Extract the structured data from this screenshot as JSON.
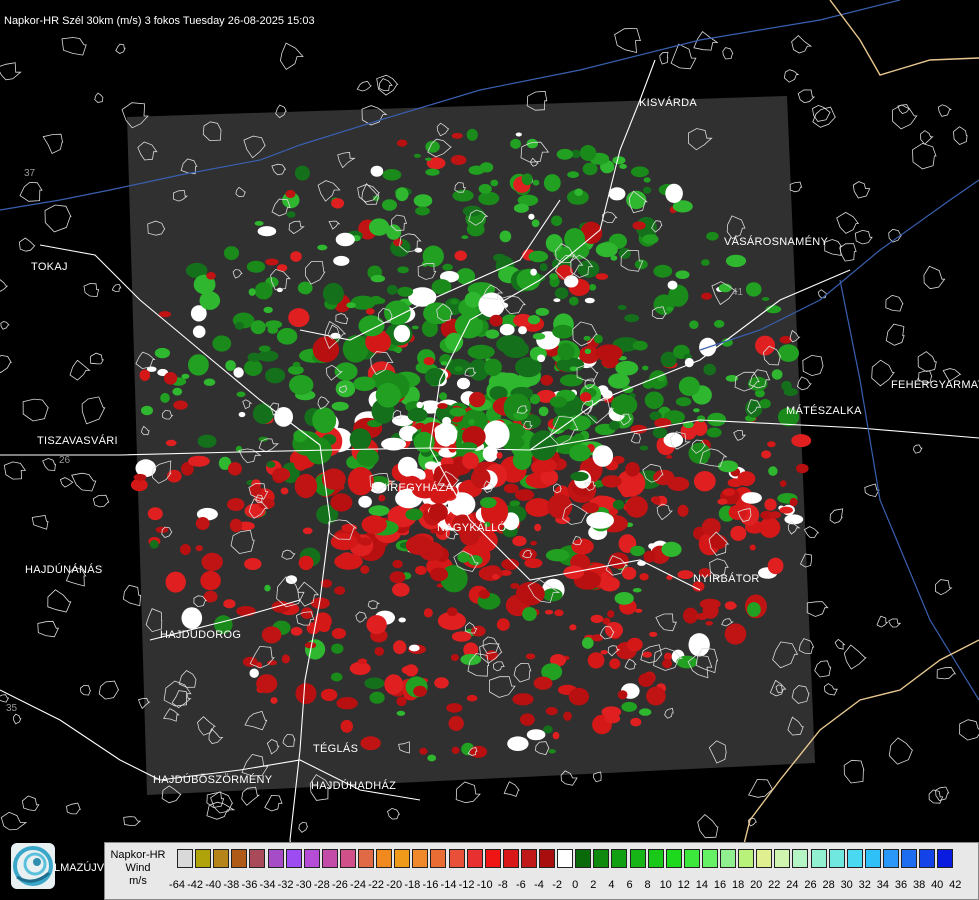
{
  "title": "Napkor-HR Szél 30km (m/s) 3 fokos Tuesday 26-08-2025 15:03",
  "cities": [
    {
      "name": "KISVÁRDA",
      "key": "kisvarda"
    },
    {
      "name": "TOKAJ",
      "key": "tokaj"
    },
    {
      "name": "VÁSÁROSNAMÉNY",
      "key": "vasarosnameny"
    },
    {
      "name": "FEHÉRGYARMAT",
      "key": "fehergyarmat"
    },
    {
      "name": "MÁTÉSZALKA",
      "key": "mateszalka"
    },
    {
      "name": "TISZAVASVÁRI",
      "key": "tiszavasvari"
    },
    {
      "name": "NYÍREGYHÁZA",
      "key": "nyiregyhaza"
    },
    {
      "name": "NAGYKÁLLÓ",
      "key": "nagykallo"
    },
    {
      "name": "NYÍRBÁTOR",
      "key": "nyirbator"
    },
    {
      "name": "HAJDÚNÁNÁS",
      "key": "hajdunanas"
    },
    {
      "name": "HAJDÚDOROG",
      "key": "hajdudorog"
    },
    {
      "name": "TÉGLÁS",
      "key": "teglas"
    },
    {
      "name": "HAJDÚBÖSZÖRMÉNY",
      "key": "hajduboszormeny"
    },
    {
      "name": "HAJDÚHADHÁZ",
      "key": "hajduhadhaz"
    }
  ],
  "road_numbers": [
    "37",
    "26",
    "41",
    "35"
  ],
  "logo": {
    "text": "LMAZÚJVÁR",
    "icon": "napkor-swirl-icon"
  },
  "legend": {
    "product_lines": [
      "Napkor-HR",
      "Wind",
      "m/s"
    ],
    "ticks": [
      "-64",
      "-42",
      "-40",
      "-38",
      "-36",
      "-34",
      "-32",
      "-30",
      "-28",
      "-26",
      "-24",
      "-22",
      "-20",
      "-18",
      "-16",
      "-14",
      "-12",
      "-10",
      "-8",
      "-6",
      "-4",
      "-2",
      "0",
      "2",
      "4",
      "6",
      "8",
      "10",
      "12",
      "14",
      "16",
      "18",
      "20",
      "22",
      "24",
      "26",
      "28",
      "30",
      "32",
      "34",
      "36",
      "38",
      "40",
      "42"
    ],
    "colors": [
      "#d9d9d9",
      "#b0a30a",
      "#b5841a",
      "#b05a18",
      "#a84a5a",
      "#a64cc6",
      "#9c4cf0",
      "#b54cd6",
      "#c34ca8",
      "#d0508a",
      "#e06a45",
      "#f08a1e",
      "#f09a1a",
      "#f0882c",
      "#e86c34",
      "#e8503a",
      "#e83030",
      "#f01515",
      "#d81818",
      "#c01818",
      "#a80e0e",
      "#ffffff",
      "#0a6a0a",
      "#0f8a0f",
      "#12a012",
      "#16b416",
      "#1ac81a",
      "#1ed81e",
      "#3ce83c",
      "#66f066",
      "#90f090",
      "#b8f27a",
      "#e0f090",
      "#cff5b0",
      "#b5f5c5",
      "#90f0d0",
      "#70e8e0",
      "#4ad8f0",
      "#30c0f8",
      "#2a98f8",
      "#1e6cf0",
      "#1444e8",
      "#0a1ce0"
    ]
  }
}
